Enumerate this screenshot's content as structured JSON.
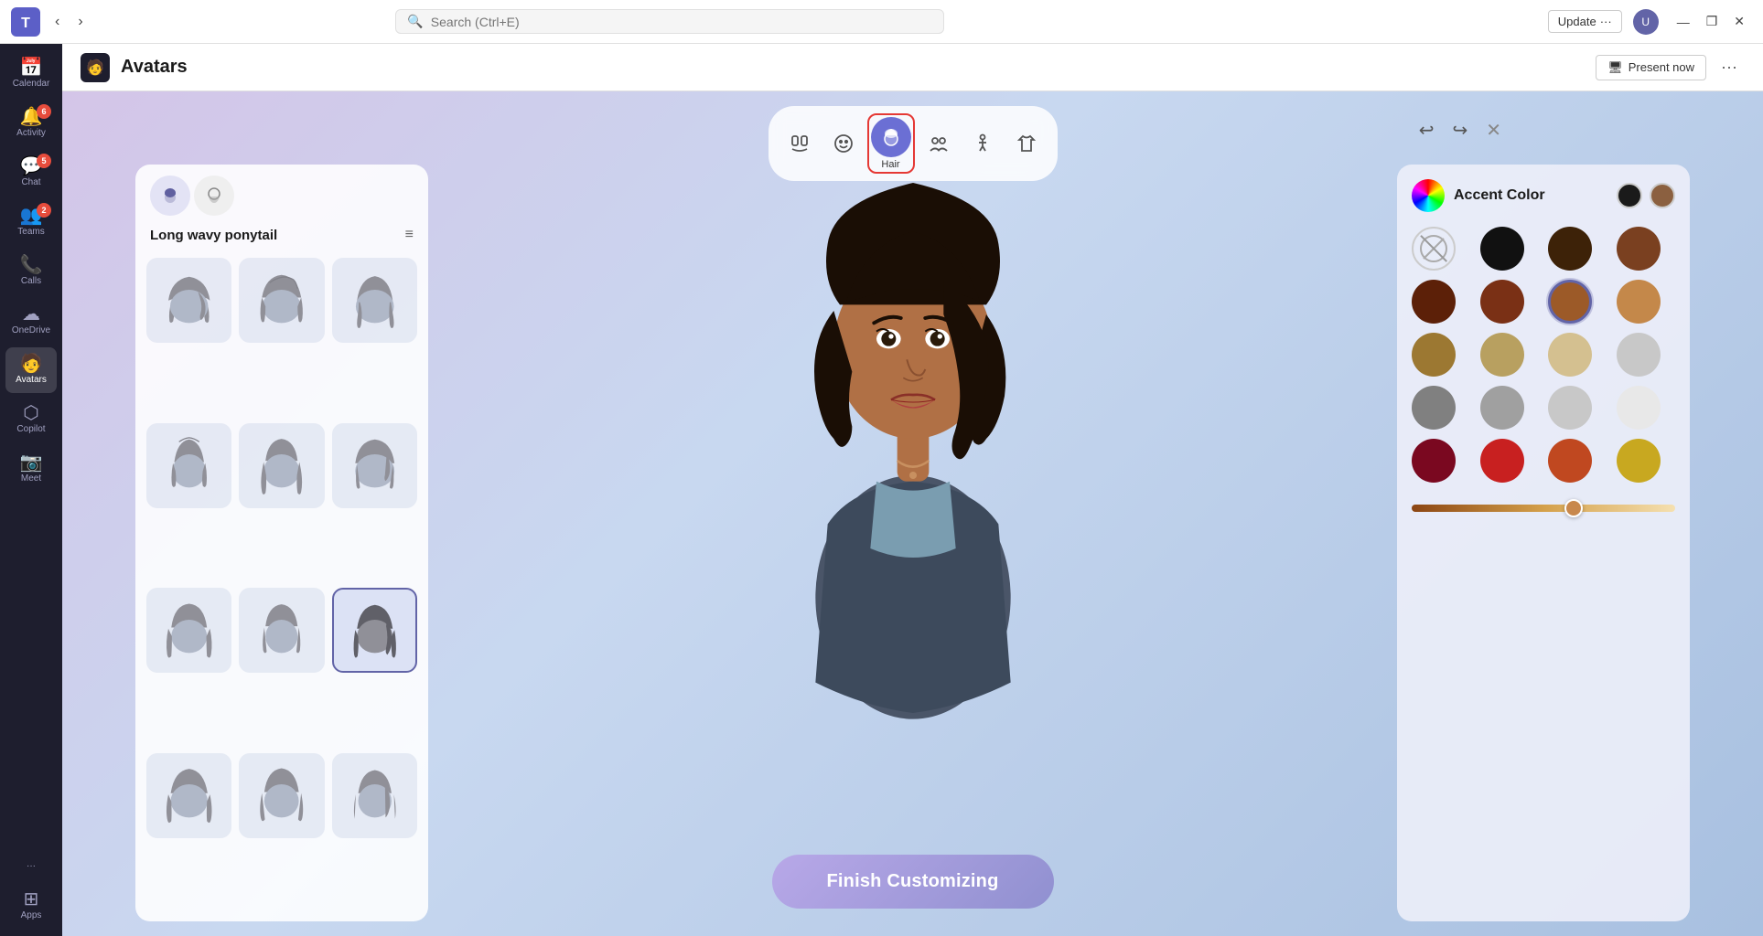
{
  "titleBar": {
    "searchPlaceholder": "Search (Ctrl+E)",
    "updateLabel": "Update",
    "moreLabel": "···",
    "minimizeLabel": "—",
    "maximizeLabel": "❐",
    "closeLabel": "✕"
  },
  "sidebar": {
    "items": [
      {
        "id": "calendar",
        "label": "Calendar",
        "icon": "📅",
        "badge": null,
        "active": false
      },
      {
        "id": "activity",
        "label": "Activity",
        "icon": "🔔",
        "badge": "6",
        "active": false
      },
      {
        "id": "chat",
        "label": "Chat",
        "icon": "💬",
        "badge": "5",
        "active": false
      },
      {
        "id": "teams",
        "label": "Teams",
        "icon": "👥",
        "badge": "2",
        "active": false
      },
      {
        "id": "calls",
        "label": "Calls",
        "icon": "📞",
        "badge": null,
        "active": false
      },
      {
        "id": "onedrive",
        "label": "OneDrive",
        "icon": "☁",
        "badge": null,
        "active": false
      },
      {
        "id": "avatars",
        "label": "Avatars",
        "icon": "🧑",
        "badge": null,
        "active": true
      },
      {
        "id": "copilot",
        "label": "Copilot",
        "icon": "⬡",
        "badge": null,
        "active": false
      },
      {
        "id": "meet",
        "label": "Meet",
        "icon": "📷",
        "badge": null,
        "active": false
      },
      {
        "id": "more",
        "label": "···",
        "icon": "···",
        "badge": null,
        "active": false
      },
      {
        "id": "apps",
        "label": "Apps",
        "icon": "⊞",
        "badge": null,
        "active": false
      }
    ]
  },
  "appHeader": {
    "title": "Avatars",
    "presentLabel": "Present now",
    "moreLabel": "···"
  },
  "toolbar": {
    "buttons": [
      {
        "id": "gesture",
        "icon": "🪆",
        "label": null,
        "selected": false
      },
      {
        "id": "face",
        "icon": "😊",
        "label": null,
        "selected": false
      },
      {
        "id": "hair",
        "icon": "👤",
        "label": "Hair",
        "selected": true
      },
      {
        "id": "group",
        "icon": "👥",
        "label": null,
        "selected": false
      },
      {
        "id": "pose",
        "icon": "🤲",
        "label": null,
        "selected": false
      },
      {
        "id": "outfit",
        "icon": "👕",
        "label": null,
        "selected": false
      }
    ]
  },
  "leftPanel": {
    "tabs": [
      {
        "id": "hair-head",
        "icon": "👤",
        "active": true
      },
      {
        "id": "beard",
        "icon": "🧔",
        "active": false
      }
    ],
    "title": "Long wavy ponytail",
    "filterIcon": "≡",
    "hairStyles": [
      {
        "id": 1,
        "selected": false
      },
      {
        "id": 2,
        "selected": false
      },
      {
        "id": 3,
        "selected": false
      },
      {
        "id": 4,
        "selected": false
      },
      {
        "id": 5,
        "selected": false
      },
      {
        "id": 6,
        "selected": false
      },
      {
        "id": 7,
        "selected": false
      },
      {
        "id": 8,
        "selected": false
      },
      {
        "id": 9,
        "selected": true
      },
      {
        "id": 10,
        "selected": false
      },
      {
        "id": 11,
        "selected": false
      },
      {
        "id": 12,
        "selected": false
      }
    ]
  },
  "rightPanel": {
    "accentColorLabel": "Accent Color",
    "selectedColors": [
      "#1a1a1a",
      "#8B6040"
    ],
    "colors": [
      {
        "id": "none",
        "hex": null,
        "label": "None",
        "isNone": true,
        "selected": false
      },
      {
        "id": "black",
        "hex": "#111111",
        "label": "Black",
        "selected": false
      },
      {
        "id": "darkbrown",
        "hex": "#3d2208",
        "label": "Dark Brown",
        "selected": false
      },
      {
        "id": "brown",
        "hex": "#7a4020",
        "label": "Brown",
        "selected": false
      },
      {
        "id": "darkchestnut",
        "hex": "#5c2008",
        "label": "Dark Chestnut",
        "selected": false
      },
      {
        "id": "chestnut",
        "hex": "#7a3015",
        "label": "Chestnut",
        "selected": false
      },
      {
        "id": "auburnbrown",
        "hex": "#9c5a28",
        "label": "Auburn Brown",
        "selected": true
      },
      {
        "id": "lightbrown",
        "hex": "#c4884a",
        "label": "Light Brown",
        "selected": false
      },
      {
        "id": "goldbrown",
        "hex": "#9c7832",
        "label": "Gold Brown",
        "selected": false
      },
      {
        "id": "darkblonde",
        "hex": "#b8a060",
        "label": "Dark Blonde",
        "selected": false
      },
      {
        "id": "blonde",
        "hex": "#d4c090",
        "label": "Blonde",
        "selected": false
      },
      {
        "id": "lightblonde",
        "hex": "#c8c8c8",
        "label": "Light Blonde",
        "selected": false
      },
      {
        "id": "darkgray",
        "hex": "#808080",
        "label": "Dark Gray",
        "selected": false
      },
      {
        "id": "gray",
        "hex": "#a0a0a0",
        "label": "Gray",
        "selected": false
      },
      {
        "id": "lightgray",
        "hex": "#c8c8c8",
        "label": "Light Gray",
        "selected": false
      },
      {
        "id": "white",
        "hex": "#e8e8e8",
        "label": "White",
        "selected": false
      },
      {
        "id": "darkred",
        "hex": "#7a0820",
        "label": "Dark Red",
        "selected": false
      },
      {
        "id": "red",
        "hex": "#c82020",
        "label": "Red",
        "selected": false
      },
      {
        "id": "auburn",
        "hex": "#c04820",
        "label": "Auburn",
        "selected": false
      },
      {
        "id": "gold",
        "hex": "#c8a820",
        "label": "Gold",
        "selected": false
      }
    ],
    "sliderValue": 58
  },
  "finishBtn": {
    "label": "Finish Customizing"
  }
}
